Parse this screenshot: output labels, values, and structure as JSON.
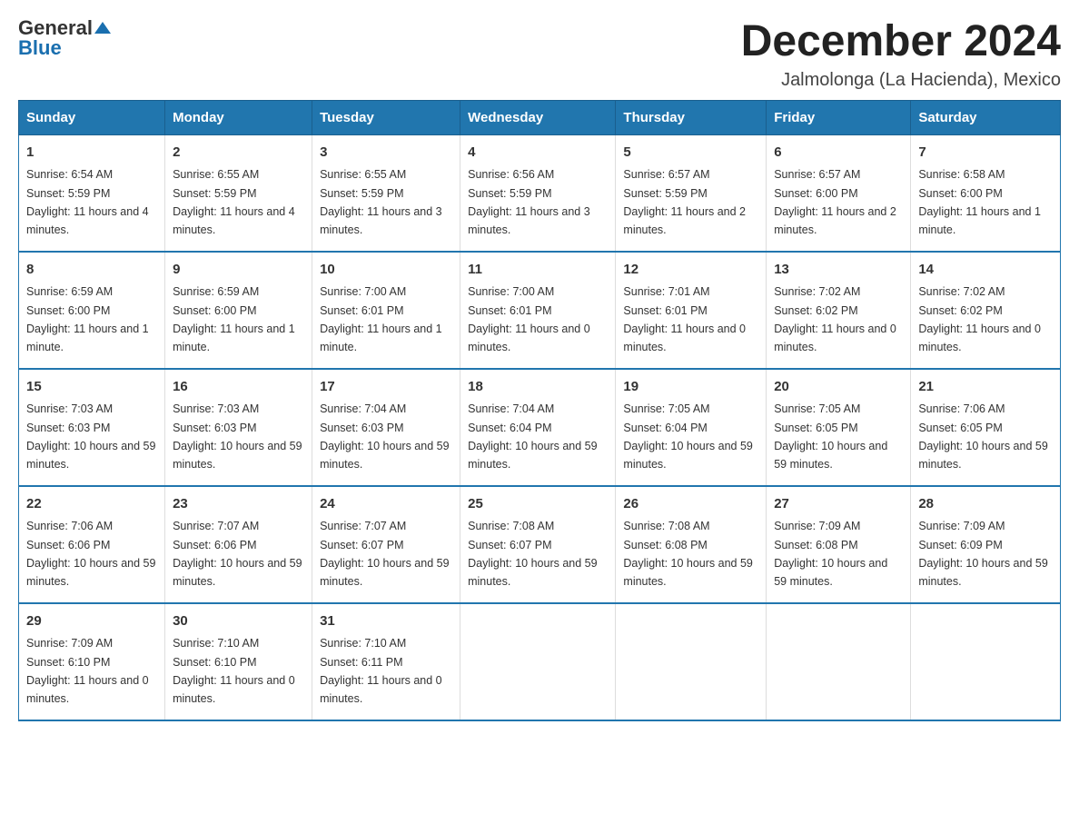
{
  "logo": {
    "text1": "General",
    "text2": "Blue"
  },
  "title": {
    "month_year": "December 2024",
    "location": "Jalmolonga (La Hacienda), Mexico"
  },
  "days_of_week": [
    "Sunday",
    "Monday",
    "Tuesday",
    "Wednesday",
    "Thursday",
    "Friday",
    "Saturday"
  ],
  "weeks": [
    [
      {
        "num": "1",
        "sunrise": "6:54 AM",
        "sunset": "5:59 PM",
        "daylight": "11 hours and 4 minutes."
      },
      {
        "num": "2",
        "sunrise": "6:55 AM",
        "sunset": "5:59 PM",
        "daylight": "11 hours and 4 minutes."
      },
      {
        "num": "3",
        "sunrise": "6:55 AM",
        "sunset": "5:59 PM",
        "daylight": "11 hours and 3 minutes."
      },
      {
        "num": "4",
        "sunrise": "6:56 AM",
        "sunset": "5:59 PM",
        "daylight": "11 hours and 3 minutes."
      },
      {
        "num": "5",
        "sunrise": "6:57 AM",
        "sunset": "5:59 PM",
        "daylight": "11 hours and 2 minutes."
      },
      {
        "num": "6",
        "sunrise": "6:57 AM",
        "sunset": "6:00 PM",
        "daylight": "11 hours and 2 minutes."
      },
      {
        "num": "7",
        "sunrise": "6:58 AM",
        "sunset": "6:00 PM",
        "daylight": "11 hours and 1 minute."
      }
    ],
    [
      {
        "num": "8",
        "sunrise": "6:59 AM",
        "sunset": "6:00 PM",
        "daylight": "11 hours and 1 minute."
      },
      {
        "num": "9",
        "sunrise": "6:59 AM",
        "sunset": "6:00 PM",
        "daylight": "11 hours and 1 minute."
      },
      {
        "num": "10",
        "sunrise": "7:00 AM",
        "sunset": "6:01 PM",
        "daylight": "11 hours and 1 minute."
      },
      {
        "num": "11",
        "sunrise": "7:00 AM",
        "sunset": "6:01 PM",
        "daylight": "11 hours and 0 minutes."
      },
      {
        "num": "12",
        "sunrise": "7:01 AM",
        "sunset": "6:01 PM",
        "daylight": "11 hours and 0 minutes."
      },
      {
        "num": "13",
        "sunrise": "7:02 AM",
        "sunset": "6:02 PM",
        "daylight": "11 hours and 0 minutes."
      },
      {
        "num": "14",
        "sunrise": "7:02 AM",
        "sunset": "6:02 PM",
        "daylight": "11 hours and 0 minutes."
      }
    ],
    [
      {
        "num": "15",
        "sunrise": "7:03 AM",
        "sunset": "6:03 PM",
        "daylight": "10 hours and 59 minutes."
      },
      {
        "num": "16",
        "sunrise": "7:03 AM",
        "sunset": "6:03 PM",
        "daylight": "10 hours and 59 minutes."
      },
      {
        "num": "17",
        "sunrise": "7:04 AM",
        "sunset": "6:03 PM",
        "daylight": "10 hours and 59 minutes."
      },
      {
        "num": "18",
        "sunrise": "7:04 AM",
        "sunset": "6:04 PM",
        "daylight": "10 hours and 59 minutes."
      },
      {
        "num": "19",
        "sunrise": "7:05 AM",
        "sunset": "6:04 PM",
        "daylight": "10 hours and 59 minutes."
      },
      {
        "num": "20",
        "sunrise": "7:05 AM",
        "sunset": "6:05 PM",
        "daylight": "10 hours and 59 minutes."
      },
      {
        "num": "21",
        "sunrise": "7:06 AM",
        "sunset": "6:05 PM",
        "daylight": "10 hours and 59 minutes."
      }
    ],
    [
      {
        "num": "22",
        "sunrise": "7:06 AM",
        "sunset": "6:06 PM",
        "daylight": "10 hours and 59 minutes."
      },
      {
        "num": "23",
        "sunrise": "7:07 AM",
        "sunset": "6:06 PM",
        "daylight": "10 hours and 59 minutes."
      },
      {
        "num": "24",
        "sunrise": "7:07 AM",
        "sunset": "6:07 PM",
        "daylight": "10 hours and 59 minutes."
      },
      {
        "num": "25",
        "sunrise": "7:08 AM",
        "sunset": "6:07 PM",
        "daylight": "10 hours and 59 minutes."
      },
      {
        "num": "26",
        "sunrise": "7:08 AM",
        "sunset": "6:08 PM",
        "daylight": "10 hours and 59 minutes."
      },
      {
        "num": "27",
        "sunrise": "7:09 AM",
        "sunset": "6:08 PM",
        "daylight": "10 hours and 59 minutes."
      },
      {
        "num": "28",
        "sunrise": "7:09 AM",
        "sunset": "6:09 PM",
        "daylight": "10 hours and 59 minutes."
      }
    ],
    [
      {
        "num": "29",
        "sunrise": "7:09 AM",
        "sunset": "6:10 PM",
        "daylight": "11 hours and 0 minutes."
      },
      {
        "num": "30",
        "sunrise": "7:10 AM",
        "sunset": "6:10 PM",
        "daylight": "11 hours and 0 minutes."
      },
      {
        "num": "31",
        "sunrise": "7:10 AM",
        "sunset": "6:11 PM",
        "daylight": "11 hours and 0 minutes."
      },
      {
        "num": "",
        "sunrise": "",
        "sunset": "",
        "daylight": ""
      },
      {
        "num": "",
        "sunrise": "",
        "sunset": "",
        "daylight": ""
      },
      {
        "num": "",
        "sunrise": "",
        "sunset": "",
        "daylight": ""
      },
      {
        "num": "",
        "sunrise": "",
        "sunset": "",
        "daylight": ""
      }
    ]
  ]
}
